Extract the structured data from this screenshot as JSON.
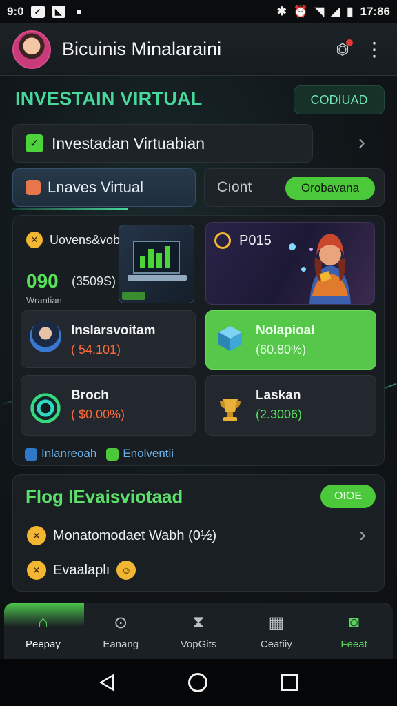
{
  "status_bar": {
    "time_left": "9:0",
    "time_right": "17:86"
  },
  "app_bar": {
    "title": "Bicuinis Minalaraini"
  },
  "section": {
    "title": "INVESTAIN VIRTUAL",
    "button_label": "CODIUAD"
  },
  "banner": {
    "label": "Investadan Virtuabian"
  },
  "tabs": {
    "active_label": "Lnaves Virtual",
    "second_label": "Cıont",
    "toggle_label": "Orobavana"
  },
  "cards": {
    "top_left": {
      "title": "Uovens&vobika",
      "big_value": "090",
      "paren_value": "(3509S)",
      "sub_label": "Wrantian"
    },
    "top_right": {
      "title": "P015"
    },
    "mid_left": {
      "name": "Inslarsvoitam",
      "value": "( 54.101)"
    },
    "mid_right": {
      "name": "Nolapioal",
      "value": "(60.80%)"
    },
    "bot_left": {
      "name": "Broch",
      "value": "( $0,00%)"
    },
    "bot_right": {
      "name": "Laskan",
      "value": "(2.3006)"
    }
  },
  "links": {
    "first": "Inlanreoah",
    "second": "Enolventii"
  },
  "lower_card": {
    "title": "Flog lEvaisviotaad",
    "chip": "OIOE",
    "row1": "Monatomodaet Wabh (0½)",
    "row2": "Evaalaplı"
  },
  "bottom_nav": {
    "items": [
      {
        "label": "Peepay"
      },
      {
        "label": "Eanang"
      },
      {
        "label": "VopGits"
      },
      {
        "label": "Ceatiiy"
      },
      {
        "label": "Feeat"
      }
    ]
  },
  "colors": {
    "accent_green": "#4cc93a",
    "heading_teal": "#47d99b",
    "negative_orange": "#ff6b3d",
    "positive_green": "#57e25a"
  }
}
